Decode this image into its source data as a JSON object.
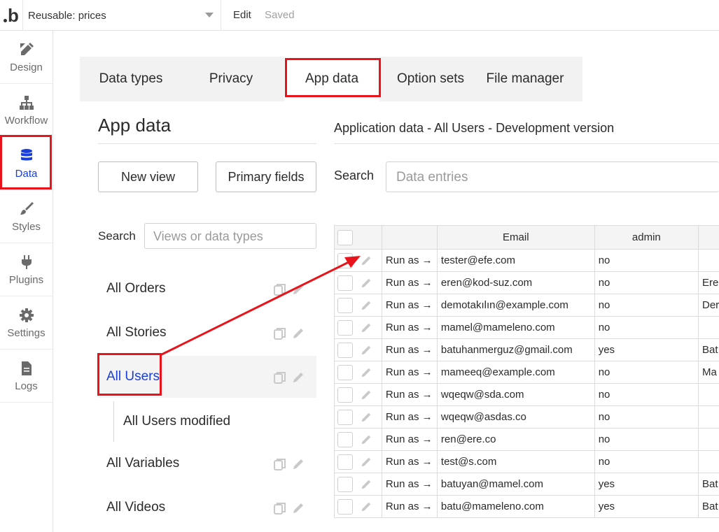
{
  "topbar": {
    "logo": "b",
    "page_select": "Reusable: prices",
    "edit": "Edit",
    "saved": "Saved"
  },
  "sidebar": {
    "items": [
      {
        "label": "Design",
        "icon": "design-icon"
      },
      {
        "label": "Workflow",
        "icon": "workflow-icon"
      },
      {
        "label": "Data",
        "icon": "database-icon",
        "active": true
      },
      {
        "label": "Styles",
        "icon": "brush-icon"
      },
      {
        "label": "Plugins",
        "icon": "plug-icon"
      },
      {
        "label": "Settings",
        "icon": "gear-icon"
      },
      {
        "label": "Logs",
        "icon": "document-icon"
      }
    ]
  },
  "tabs": [
    {
      "label": "Data types"
    },
    {
      "label": "Privacy"
    },
    {
      "label": "App data",
      "active": true
    },
    {
      "label": "Option sets"
    },
    {
      "label": "File manager"
    }
  ],
  "left_panel": {
    "title": "App data",
    "new_view": "New view",
    "primary_fields": "Primary fields",
    "search_label": "Search",
    "search_placeholder": "Views or data types",
    "views": [
      {
        "label": "All Orders"
      },
      {
        "label": "All Stories"
      },
      {
        "label": "All Users",
        "selected": true
      },
      {
        "label": "All Users modified",
        "sub": true
      },
      {
        "label": "All Variables"
      },
      {
        "label": "All Videos"
      }
    ]
  },
  "right_panel": {
    "heading": "Application data - All Users - Development version",
    "search_label": "Search",
    "search_placeholder": "Data entries",
    "columns": [
      "Email",
      "admin"
    ],
    "rows": [
      {
        "run": "Run as →",
        "email": "tester@efe.com",
        "admin": "no",
        "name": ""
      },
      {
        "run": "Run as →",
        "email": "eren@kod-suz.com",
        "admin": "no",
        "name": "Ere"
      },
      {
        "run": "Run as →",
        "email": "demotakılın@example.com",
        "admin": "no",
        "name": "Der"
      },
      {
        "run": "Run as →",
        "email": "mamel@mameleno.com",
        "admin": "no",
        "name": ""
      },
      {
        "run": "Run as →",
        "email": "batuhanmerguz@gmail.com",
        "admin": "yes",
        "name": "Bat"
      },
      {
        "run": "Run as →",
        "email": "mameeq@example.com",
        "admin": "no",
        "name": "Ma"
      },
      {
        "run": "Run as →",
        "email": "wqeqw@sda.com",
        "admin": "no",
        "name": ""
      },
      {
        "run": "Run as →",
        "email": "wqeqw@asdas.co",
        "admin": "no",
        "name": ""
      },
      {
        "run": "Run as →",
        "email": "ren@ere.co",
        "admin": "no",
        "name": ""
      },
      {
        "run": "Run as →",
        "email": "test@s.com",
        "admin": "no",
        "name": ""
      },
      {
        "run": "Run as →",
        "email": "batuyan@mamel.com",
        "admin": "yes",
        "name": "Bat"
      },
      {
        "run": "Run as →",
        "email": "batu@mameleno.com",
        "admin": "yes",
        "name": "Bat"
      }
    ]
  },
  "colors": {
    "accent": "#1a3ed8",
    "highlight": "#e8131b",
    "tabbar_bg": "#f2f2f2"
  }
}
